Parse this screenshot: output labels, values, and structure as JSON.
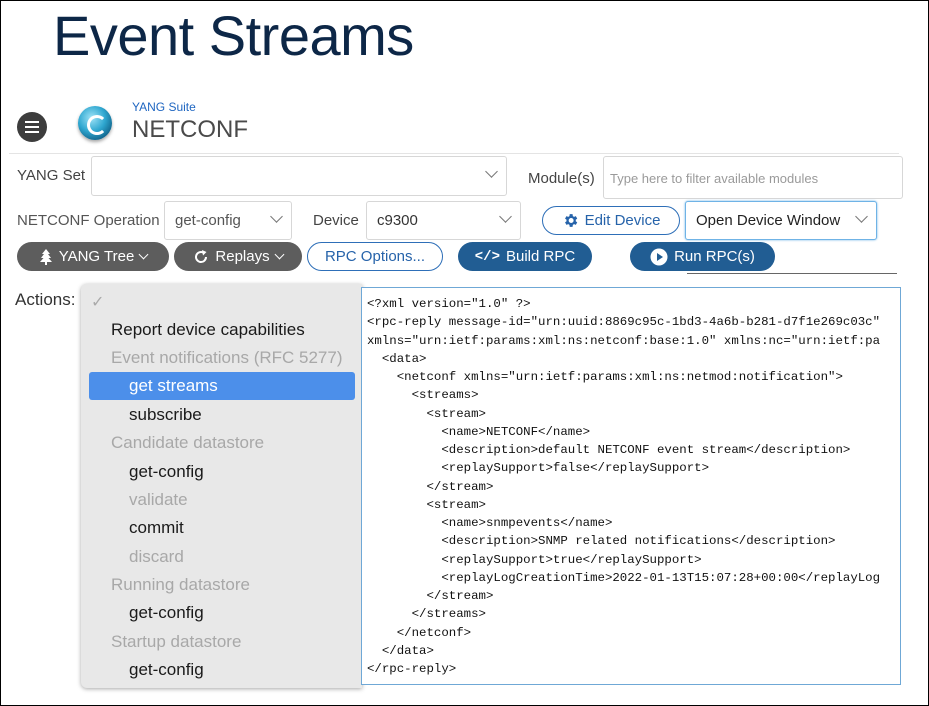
{
  "slide_title": "Event Streams",
  "app": {
    "subtitle": "YANG Suite",
    "title": "NETCONF"
  },
  "filters": {
    "yang_set_label": "YANG Set",
    "yang_set_value": "",
    "modules_label": "Module(s)",
    "modules_placeholder": "Type here to filter available modules",
    "operation_label": "NETCONF Operation",
    "operation_value": "get-config",
    "device_label": "Device",
    "device_value": "c9300",
    "edit_device_label": "Edit Device",
    "open_window_value": "Open Device Window"
  },
  "toolbar": {
    "yang_tree": "YANG Tree",
    "replays": "Replays",
    "rpc_options": "RPC Options...",
    "build_rpc": "Build RPC",
    "run_rpc": "Run RPC(s)"
  },
  "actions": {
    "label": "Actions:",
    "checkmark": "✓",
    "items": [
      {
        "label": "Report device capabilities",
        "state": "enabled"
      },
      {
        "label": "Event notifications (RFC 5277)",
        "state": "disabled"
      },
      {
        "label": "get streams",
        "state": "selected"
      },
      {
        "label": "subscribe",
        "state": "enabled"
      },
      {
        "label": "Candidate datastore",
        "state": "disabled"
      },
      {
        "label": "get-config",
        "state": "enabled"
      },
      {
        "label": "validate",
        "state": "disabled"
      },
      {
        "label": "commit",
        "state": "enabled"
      },
      {
        "label": "discard",
        "state": "disabled"
      },
      {
        "label": "Running datastore",
        "state": "disabled"
      },
      {
        "label": "get-config",
        "state": "enabled"
      },
      {
        "label": "Startup datastore",
        "state": "disabled"
      },
      {
        "label": "get-config",
        "state": "enabled"
      }
    ]
  },
  "xml_lines": [
    "<?xml version=\"1.0\" ?>",
    "<rpc-reply message-id=\"urn:uuid:8869c95c-1bd3-4a6b-b281-d7f1e269c03c\"",
    "xmlns=\"urn:ietf:params:xml:ns:netconf:base:1.0\" xmlns:nc=\"urn:ietf:pa",
    "  <data>",
    "    <netconf xmlns=\"urn:ietf:params:xml:ns:netmod:notification\">",
    "      <streams>",
    "        <stream>",
    "          <name>NETCONF</name>",
    "          <description>default NETCONF event stream</description>",
    "          <replaySupport>false</replaySupport>",
    "        </stream>",
    "        <stream>",
    "          <name>snmpevents</name>",
    "          <description>SNMP related notifications</description>",
    "          <replaySupport>true</replaySupport>",
    "          <replayLogCreationTime>2022-01-13T15:07:28+00:00</replayLog",
    "        </stream>",
    "      </streams>",
    "    </netconf>",
    "  </data>",
    "</rpc-reply>"
  ],
  "colors": {
    "title": "#0d2747",
    "accent_blue": "#215d93",
    "selection": "#4c8fea"
  }
}
